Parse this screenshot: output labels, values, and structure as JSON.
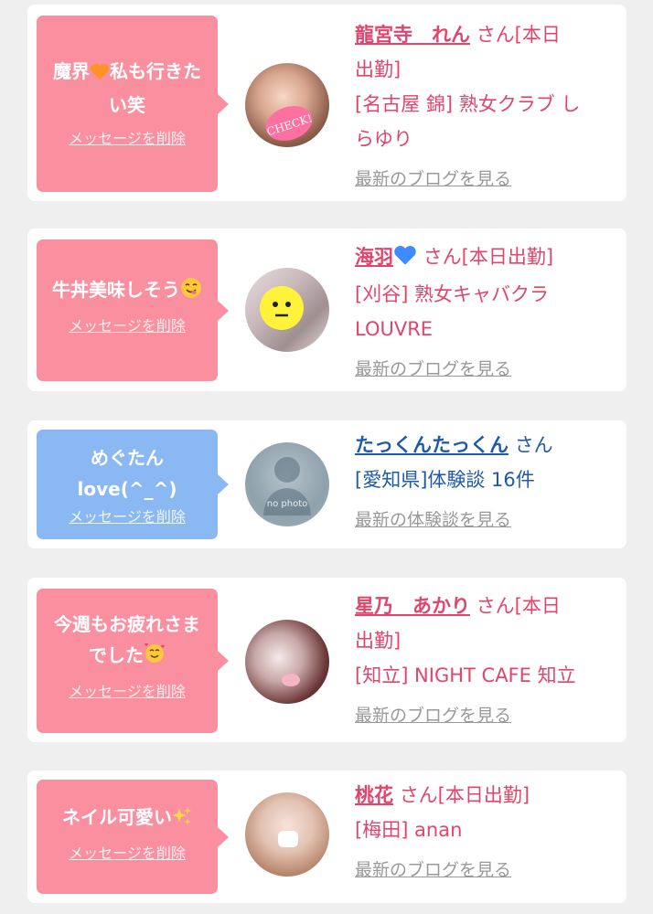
{
  "colors": {
    "page_bg": "#efefef",
    "card_bg": "#ffffff",
    "pink_bubble": "#fa8fa0",
    "blue_bubble": "#8ab8f2",
    "pink_text": "#e2456b",
    "blue_text": "#1f5aa8",
    "link_gray": "#999999"
  },
  "items": [
    {
      "message_line1": "魔界",
      "message_emoji": "orange-heart",
      "message_line1b": "私も行きた",
      "message_line2": "い笑",
      "delete_label": "メッセージを削除",
      "name": "龍宮寺　れん",
      "suffix": "さん[本日",
      "suffix2": "出勤]",
      "shop_line1": "[名古屋 錦] 熟女クラブ し",
      "shop_line2": "らゆり",
      "more_label": "最新のブログを見る",
      "avatar_badge": "CHECK!"
    },
    {
      "message_line1": "牛丼美味しそう",
      "message_emoji": "smiling-face-savoring",
      "delete_label": "メッセージを削除",
      "name": "海羽",
      "name_emoji": "blue-heart",
      "suffix": "さん[本日出勤]",
      "shop_line1": "[刈谷] 熟女キャバクラ",
      "shop_line2": "LOUVRE",
      "more_label": "最新のブログを見る"
    },
    {
      "message_line1": "めぐたん",
      "message_line2": "love(^_^)",
      "delete_label": "メッセージを削除",
      "name": "たっくんたっくん",
      "suffix": "さん",
      "shop_line1": "[愛知県]体験談 16件",
      "more_label": "最新の体験談を見る",
      "avatar_text": "no photo"
    },
    {
      "message_line1": "今週もお疲れさま",
      "message_line2": "でした",
      "message_emoji": "smiling-face-with-hearts",
      "delete_label": "メッセージを削除",
      "name": "星乃　あかり",
      "suffix": "さん[本日",
      "suffix2": "出勤]",
      "shop_line1": "[知立] NIGHT CAFE 知立",
      "more_label": "最新のブログを見る"
    },
    {
      "message_line1": "ネイル可愛い",
      "message_emoji": "sparkles",
      "delete_label": "メッセージを削除",
      "name": "桃花",
      "suffix": "さん[本日出勤]",
      "shop_line1": "[梅田] anan",
      "more_label": "最新のブログを見る"
    }
  ]
}
